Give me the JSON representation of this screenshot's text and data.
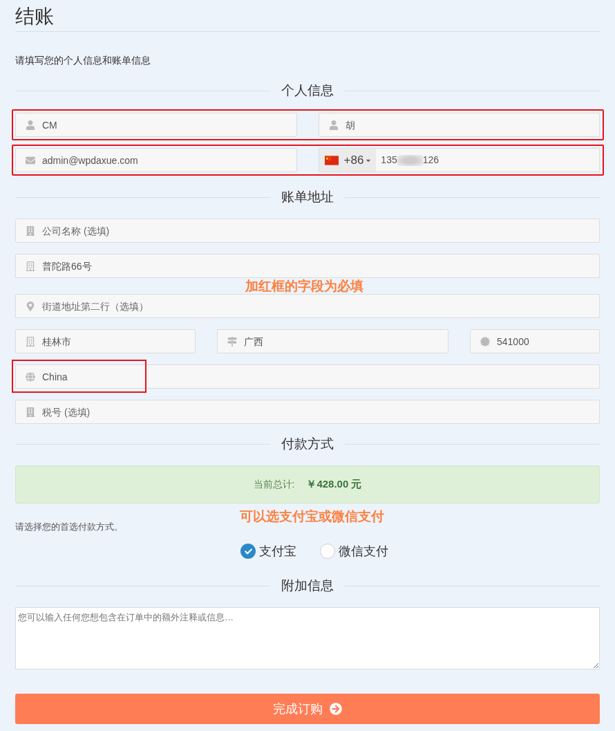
{
  "title": "结账",
  "intro": "请填写您的个人信息和账单信息",
  "personal": {
    "heading": "个人信息",
    "rows": [
      {
        "highlighted": true,
        "fields": [
          {
            "kind": "name",
            "value": "CM"
          },
          {
            "kind": "name",
            "value": "胡"
          }
        ]
      },
      {
        "highlighted": true,
        "fields": [
          {
            "kind": "email",
            "value": "admin@wpdaxue.com"
          },
          {
            "kind": "phone",
            "country_code": "+86",
            "value_parts": [
              "135",
              "126"
            ]
          }
        ]
      }
    ]
  },
  "billing": {
    "heading": "账单地址",
    "rows": [
      {
        "fields": [
          {
            "kind": "company",
            "placeholder": "公司名称 (选填)"
          }
        ]
      },
      {
        "fields": [
          {
            "kind": "street",
            "value": "普陀路66号"
          }
        ],
        "note": "加红框的字段为必填"
      },
      {
        "fields": [
          {
            "kind": "location",
            "placeholder": "街道地址第二行（选填）"
          }
        ]
      },
      {
        "fields": [
          {
            "kind": "city",
            "value": "桂林市"
          },
          {
            "kind": "region",
            "value": "广西"
          },
          {
            "kind": "postcode",
            "value": "541000"
          }
        ]
      },
      {
        "fields": [
          {
            "kind": "country",
            "value": "China",
            "value_highlighted": true
          }
        ]
      },
      {
        "fields": [
          {
            "kind": "tax",
            "placeholder": "税号 (选填)"
          }
        ]
      }
    ]
  },
  "payment": {
    "heading": "付款方式",
    "total_label": "当前总计:",
    "total_amount": "￥428.00 元",
    "note": "可以选支付宝或微信支付",
    "prompt": "请选择您的首选付款方式。",
    "options": [
      {
        "label": "支付宝",
        "selected": true
      },
      {
        "label": "微信支付",
        "selected": false
      }
    ]
  },
  "extra": {
    "heading": "附加信息",
    "placeholder": "您可以输入任何您想包含在订单中的额外注释或信息…"
  },
  "submit": {
    "label": "完成订购"
  }
}
